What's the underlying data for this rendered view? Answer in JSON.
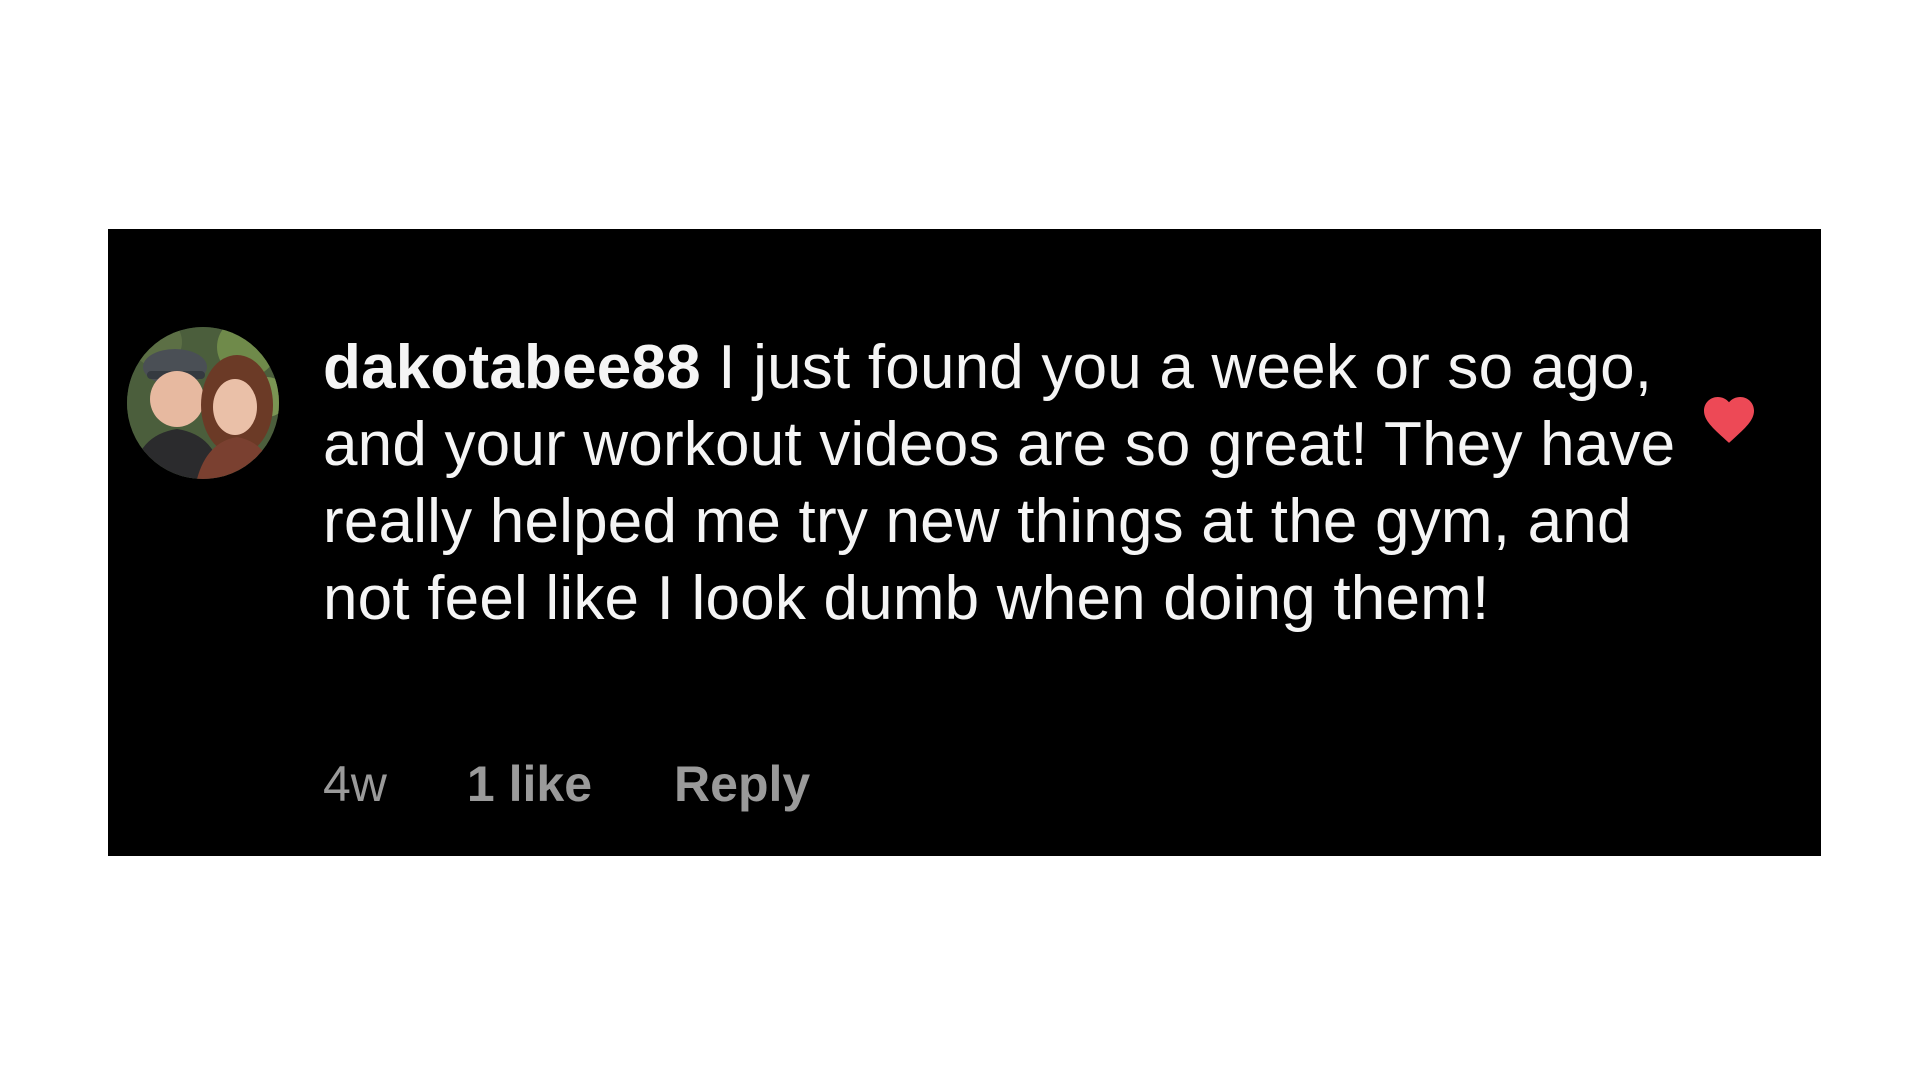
{
  "comment": {
    "username": "dakotabee88",
    "text": "I just found you a week or so ago, and your workout videos are so great! They have really helped me try new things at the gym, and not feel like I look dumb when doing them!",
    "time": "4w",
    "likes": "1 like",
    "reply_label": "Reply",
    "avatar_icon": "profile-photo",
    "like_icon": "heart-icon",
    "like_color": "#ed4956"
  }
}
